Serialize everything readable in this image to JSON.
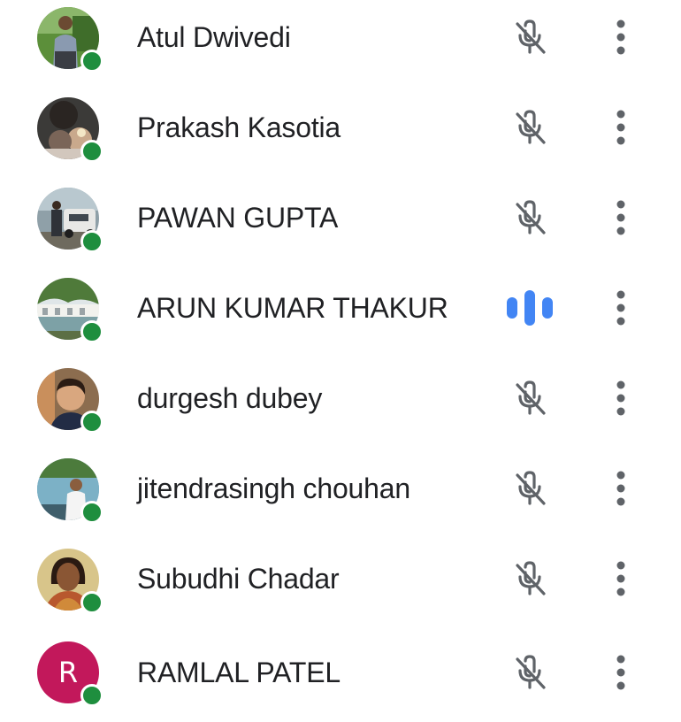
{
  "participants": [
    {
      "name": "Atul Dwivedi",
      "online": true,
      "mic": "muted",
      "avatar": "photo-man-outdoor-green"
    },
    {
      "name": "Prakash Kasotia",
      "online": true,
      "mic": "muted",
      "avatar": "photo-dark-group"
    },
    {
      "name": "PAWAN GUPTA",
      "online": true,
      "mic": "muted",
      "avatar": "photo-man-by-car"
    },
    {
      "name": "ARUN KUMAR THAKUR",
      "online": true,
      "mic": "speaking",
      "avatar": "photo-landscape-building"
    },
    {
      "name": "durgesh dubey",
      "online": true,
      "mic": "muted",
      "avatar": "photo-man-portrait"
    },
    {
      "name": "jitendrasingh chouhan",
      "online": true,
      "mic": "muted",
      "avatar": "photo-man-waterfront"
    },
    {
      "name": "Subudhi Chadar",
      "online": true,
      "mic": "muted",
      "avatar": "photo-woman-portrait"
    },
    {
      "name": "RAMLAL PATEL",
      "online": true,
      "mic": "muted",
      "avatar": "letter",
      "avatar_letter": "R",
      "avatar_color": "#c2185b"
    }
  ],
  "colors": {
    "online_status": "#1e8e3e",
    "muted_icon": "#5f6368",
    "speaking_icon": "#4285f4",
    "more_icon": "#5f6368",
    "name_text": "#202124"
  },
  "icons": {
    "muted": "mic-off-icon",
    "speaking": "audio-level-icon",
    "more": "more-vert-icon"
  }
}
